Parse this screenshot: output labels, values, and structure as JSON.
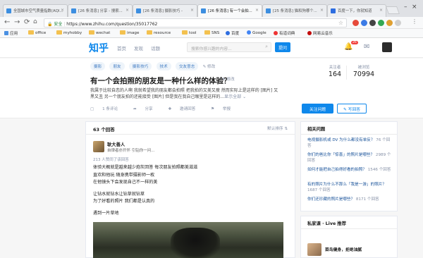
{
  "browser": {
    "tabs": [
      {
        "title": "全国城市空气质量指数(AQI..."
      },
      {
        "title": "[26 条消息] 分享 - 搜索..."
      },
      {
        "title": "[26 条消息] 摄影技巧 -"
      },
      {
        "title": "[26 条消息] 有一个会拍..."
      },
      {
        "title": "[25 条消息] 猫和狗哪个..."
      },
      {
        "title": "百度一下，你就知道"
      }
    ],
    "secure_label": "安全",
    "url": "https://www.zhihu.com/question/35017762",
    "bookmarks": [
      "应用",
      "office",
      "myhobby",
      "wechat",
      "image",
      "resource",
      "tool",
      "SNS",
      "百度",
      "Google",
      "有道词典",
      "网易云音乐"
    ]
  },
  "zhihu": {
    "logo": "知乎",
    "nav": [
      "首页",
      "发现",
      "话题"
    ],
    "search_placeholder": "搜索你感兴趣的内容...",
    "ask_label": "提问",
    "notification_count": "26",
    "colors": {
      "brand": "#0f88eb",
      "link": "#175199"
    }
  },
  "question": {
    "topics": [
      "摄影",
      "朋友",
      "摄影技巧",
      "技术",
      "交友意志"
    ],
    "topic_edit": "修改",
    "title": "有一个会拍照的朋友是一种什么样的体验？",
    "title_edit": "修改",
    "detail_line1": "我属于比较自恋的人啊 我就希望我的朋友都会拍照 把我拍的又美又瘦 然而实际上是这样的 [图片] 又",
    "detail_line2": "黑又丑 另一个朋友拍的还能接受 [图片] 但是我在我自己眼里是这样的...",
    "detail_more": "显示全部",
    "actions": [
      "1 条评论",
      "分享",
      "邀请回答",
      "举报"
    ],
    "followers_label": "关注者",
    "followers": "164",
    "views_label": "被浏览",
    "views": "70994",
    "follow_btn": "关注问题",
    "write_btn": "写回答"
  },
  "answers": {
    "count": "63 个回答",
    "sort": "默认排序",
    "first": {
      "author": "耿大善人",
      "bio": "自律者亦开怀 引钻你一问...",
      "votes": "213 人赞同了该回答",
      "lines": [
        "体验大概就是越来越少炮灰回答 每次朋友拍照都美滋滋",
        "直欢和他玩 随身携带摄影师一枚",
        "在他镜头下会发现自己不一样的美",
        "",
        "让钻水就钻水让钻草就钻草",
        "为了好看的照片 我们都是认真的",
        "",
        "遇到一片草地"
      ]
    }
  },
  "related": {
    "title": "相关问题",
    "items": [
      {
        "q": "电视摄影机或 DV 为什么都没有单反？",
        "count": "76 个回答"
      },
      {
        "q": "你们的爸比你「惊喜」的照片是哪些？",
        "count": "2989 个回答"
      },
      {
        "q": "如何才能把自己拍得好看的拍照？",
        "count": "1546 个回答"
      },
      {
        "q": "有的照片为什么不那么「我是一游」的照片？",
        "count": "1687 个回答"
      },
      {
        "q": "你们还珍藏的照片是哪些？",
        "count": "8171 个回答"
      }
    ]
  },
  "live": {
    "title": "私家课 · Live 推荐",
    "item": "菜鸟健身，拒绝油腻"
  }
}
